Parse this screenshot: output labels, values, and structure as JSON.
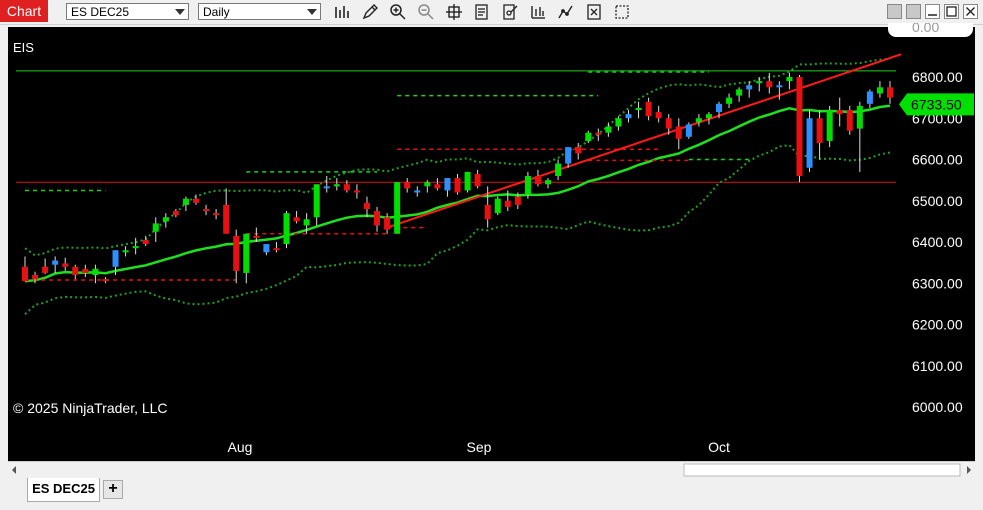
{
  "toolbar": {
    "tab_label": "Chart",
    "instrument": "ES DEC25",
    "period": "Daily",
    "tools": [
      "bar-type-icon",
      "draw-pencil-icon",
      "zoom-in-icon",
      "zoom-out-icon",
      "crosshair-icon",
      "data-box-icon",
      "properties-icon",
      "indicators-icon",
      "strategies-icon",
      "template-icon",
      "show-all-icon"
    ]
  },
  "chart": {
    "instrument_label": "EIS",
    "copyright": "© 2025 NinjaTrader, LLC",
    "current_price": "6733.50",
    "top_cut_label": "0.00",
    "colors": {
      "background": "#000000",
      "up_candle": "#00e000",
      "down_candle": "#e81010",
      "blue_candle": "#2e8fff",
      "sma": "#1ee01e",
      "bands": "#22a022",
      "trendline": "#ff1a1a"
    }
  },
  "chart_data": {
    "type": "candlestick",
    "y_ticks": [
      "6800.00",
      "6700.00",
      "6600.00",
      "6500.00",
      "6400.00",
      "6300.00",
      "6200.00",
      "6100.00",
      "6000.00"
    ],
    "ylim": [
      5965,
      6900
    ],
    "x_ticks": [
      "Aug",
      "Sep",
      "Oct"
    ],
    "last_price": 6733.5,
    "horizontal_lines": [
      6815,
      6545
    ],
    "trendline": [
      [
        6435,
        6850
      ]
    ],
    "candles": [
      [
        6340,
        6365,
        6305,
        6305
      ],
      [
        6320,
        6328,
        6300,
        6310
      ],
      [
        6340,
        6360,
        6322,
        6325
      ],
      [
        6345,
        6365,
        6325,
        6355
      ],
      [
        6348,
        6362,
        6330,
        6340
      ],
      [
        6340,
        6345,
        6310,
        6320
      ],
      [
        6335,
        6345,
        6315,
        6325
      ],
      [
        6320,
        6345,
        6300,
        6335
      ],
      [
        6310,
        6315,
        6300,
        6305
      ],
      [
        6340,
        6380,
        6320,
        6380
      ],
      [
        6375,
        6390,
        6365,
        6380
      ],
      [
        6385,
        6410,
        6370,
        6390
      ],
      [
        6405,
        6415,
        6390,
        6395
      ],
      [
        6425,
        6460,
        6400,
        6445
      ],
      [
        6450,
        6470,
        6435,
        6460
      ],
      [
        6475,
        6480,
        6460,
        6465
      ],
      [
        6490,
        6510,
        6475,
        6505
      ],
      [
        6505,
        6515,
        6490,
        6495
      ],
      [
        6480,
        6490,
        6465,
        6475
      ],
      [
        6470,
        6480,
        6455,
        6465
      ],
      [
        6490,
        6530,
        6420,
        6420
      ],
      [
        6415,
        6430,
        6300,
        6330
      ],
      [
        6325,
        6420,
        6300,
        6420
      ],
      [
        6415,
        6435,
        6400,
        6410
      ],
      [
        6375,
        6395,
        6368,
        6395
      ],
      [
        6385,
        6400,
        6375,
        6380
      ],
      [
        6395,
        6475,
        6385,
        6470
      ],
      [
        6460,
        6475,
        6445,
        6450
      ],
      [
        6440,
        6470,
        6420,
        6455
      ],
      [
        6460,
        6540,
        6440,
        6540
      ],
      [
        6530,
        6560,
        6520,
        6535
      ],
      [
        6535,
        6555,
        6525,
        6540
      ],
      [
        6540,
        6550,
        6520,
        6525
      ],
      [
        6525,
        6540,
        6505,
        6520
      ],
      [
        6495,
        6510,
        6460,
        6480
      ],
      [
        6475,
        6485,
        6425,
        6440
      ],
      [
        6460,
        6470,
        6420,
        6430
      ],
      [
        6420,
        6545,
        6420,
        6545
      ],
      [
        6545,
        6555,
        6520,
        6530
      ],
      [
        6520,
        6535,
        6510,
        6525
      ],
      [
        6535,
        6550,
        6520,
        6545
      ],
      [
        6540,
        6555,
        6525,
        6530
      ],
      [
        6525,
        6555,
        6510,
        6555
      ],
      [
        6555,
        6565,
        6515,
        6520
      ],
      [
        6525,
        6570,
        6520,
        6570
      ],
      [
        6565,
        6575,
        6530,
        6535
      ],
      [
        6490,
        6535,
        6435,
        6455
      ],
      [
        6470,
        6510,
        6465,
        6505
      ],
      [
        6500,
        6525,
        6475,
        6485
      ],
      [
        6510,
        6520,
        6480,
        6490
      ],
      [
        6515,
        6570,
        6505,
        6560
      ],
      [
        6560,
        6575,
        6535,
        6540
      ],
      [
        6540,
        6555,
        6530,
        6550
      ],
      [
        6560,
        6600,
        6550,
        6590
      ],
      [
        6590,
        6630,
        6580,
        6630
      ],
      [
        6630,
        6640,
        6600,
        6615
      ],
      [
        6645,
        6670,
        6640,
        6665
      ],
      [
        6665,
        6675,
        6645,
        6660
      ],
      [
        6665,
        6690,
        6655,
        6680
      ],
      [
        6680,
        6705,
        6670,
        6700
      ],
      [
        6700,
        6720,
        6690,
        6710
      ],
      [
        6720,
        6740,
        6700,
        6725
      ],
      [
        6740,
        6750,
        6695,
        6705
      ],
      [
        6715,
        6730,
        6690,
        6700
      ],
      [
        6700,
        6710,
        6660,
        6675
      ],
      [
        6680,
        6700,
        6625,
        6650
      ],
      [
        6655,
        6690,
        6650,
        6685
      ],
      [
        6690,
        6710,
        6680,
        6700
      ],
      [
        6700,
        6715,
        6685,
        6710
      ],
      [
        6715,
        6740,
        6700,
        6735
      ],
      [
        6735,
        6760,
        6725,
        6750
      ],
      [
        6755,
        6775,
        6740,
        6770
      ],
      [
        6770,
        6790,
        6750,
        6780
      ],
      [
        6785,
        6800,
        6765,
        6790
      ],
      [
        6790,
        6810,
        6760,
        6775
      ],
      [
        6775,
        6790,
        6745,
        6780
      ],
      [
        6790,
        6810,
        6770,
        6800
      ],
      [
        6800,
        6805,
        6545,
        6560
      ],
      [
        6580,
        6720,
        6570,
        6700
      ],
      [
        6700,
        6720,
        6600,
        6640
      ],
      [
        6645,
        6730,
        6630,
        6720
      ],
      [
        6720,
        6750,
        6680,
        6710
      ],
      [
        6720,
        6730,
        6660,
        6670
      ],
      [
        6675,
        6740,
        6570,
        6730
      ],
      [
        6735,
        6770,
        6725,
        6765
      ],
      [
        6760,
        6790,
        6750,
        6775
      ],
      [
        6775,
        6790,
        6735,
        6750
      ]
    ]
  }
}
